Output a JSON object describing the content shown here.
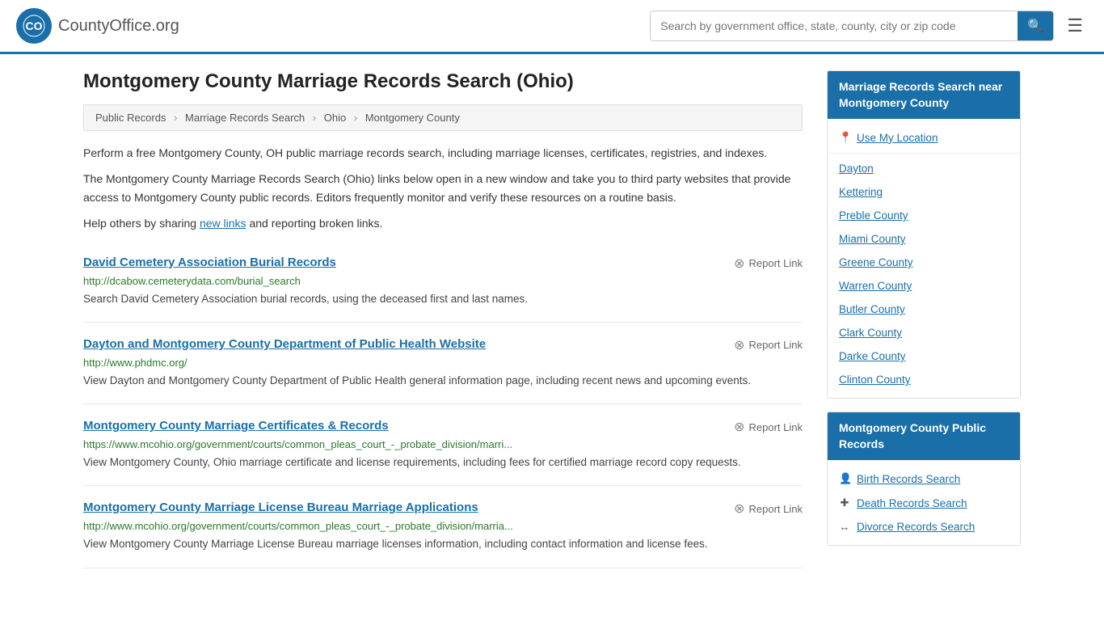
{
  "header": {
    "logo_text": "CountyOffice",
    "logo_suffix": ".org",
    "search_placeholder": "Search by government office, state, county, city or zip code",
    "search_button_label": "🔍"
  },
  "page": {
    "title": "Montgomery County Marriage Records Search (Ohio)",
    "breadcrumb": [
      {
        "label": "Public Records",
        "href": "#"
      },
      {
        "label": "Marriage Records Search",
        "href": "#"
      },
      {
        "label": "Ohio",
        "href": "#"
      },
      {
        "label": "Montgomery County",
        "href": "#"
      }
    ],
    "intro1": "Perform a free Montgomery County, OH public marriage records search, including marriage licenses, certificates, registries, and indexes.",
    "intro2": "The Montgomery County Marriage Records Search (Ohio) links below open in a new window and take you to third party websites that provide access to Montgomery County public records. Editors frequently monitor and verify these resources on a routine basis.",
    "intro3_before": "Help others by sharing ",
    "intro3_link": "new links",
    "intro3_after": " and reporting broken links."
  },
  "records": [
    {
      "title": "David Cemetery Association Burial Records",
      "url": "http://dcabow.cemeterydata.com/burial_search",
      "desc": "Search David Cemetery Association burial records, using the deceased first and last names.",
      "report": "Report Link"
    },
    {
      "title": "Dayton and Montgomery County Department of Public Health Website",
      "url": "http://www.phdmc.org/",
      "desc": "View Dayton and Montgomery County Department of Public Health general information page, including recent news and upcoming events.",
      "report": "Report Link"
    },
    {
      "title": "Montgomery County Marriage Certificates & Records",
      "url": "https://www.mcohio.org/government/courts/common_pleas_court_-_probate_division/marri...",
      "desc": "View Montgomery County, Ohio marriage certificate and license requirements, including fees for certified marriage record copy requests.",
      "report": "Report Link"
    },
    {
      "title": "Montgomery County Marriage License Bureau Marriage Applications",
      "url": "http://www.mcohio.org/government/courts/common_pleas_court_-_probate_division/marria...",
      "desc": "View Montgomery County Marriage License Bureau marriage licenses information, including contact information and license fees.",
      "report": "Report Link"
    }
  ],
  "sidebar": {
    "section1": {
      "header": "Marriage Records Search near Montgomery County",
      "items": [
        {
          "icon": "📍",
          "label": "Use My Location",
          "type": "location"
        },
        {
          "label": "Dayton"
        },
        {
          "label": "Kettering"
        },
        {
          "label": "Preble County"
        },
        {
          "label": "Miami County"
        },
        {
          "label": "Greene County"
        },
        {
          "label": "Warren County"
        },
        {
          "label": "Butler County"
        },
        {
          "label": "Clark County"
        },
        {
          "label": "Darke County"
        },
        {
          "label": "Clinton County"
        }
      ]
    },
    "section2": {
      "header": "Montgomery County Public Records",
      "items": [
        {
          "icon": "👤",
          "label": "Birth Records Search"
        },
        {
          "icon": "+",
          "label": "Death Records Search"
        },
        {
          "icon": "↔",
          "label": "Divorce Records Search"
        }
      ]
    }
  }
}
